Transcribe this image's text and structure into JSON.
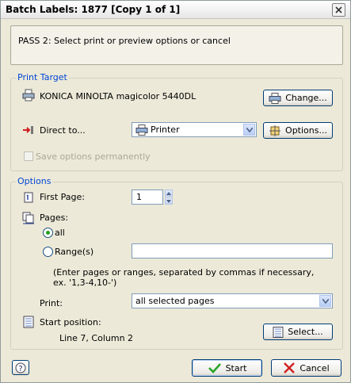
{
  "window": {
    "title": "Batch Labels: 1877 [Copy 1 of 1]"
  },
  "info": {
    "text": "PASS 2: Select print or preview options or cancel"
  },
  "print_target": {
    "legend": "Print Target",
    "printer_name": "KONICA MINOLTA magicolor 5440DL",
    "change_label": "Change...",
    "direct_to_label": "Direct to...",
    "direct_to_value": "Printer",
    "options_label": "Options...",
    "save_options_label": "Save options permanently",
    "save_options_checked": false
  },
  "options": {
    "legend": "Options",
    "first_page_label": "First Page:",
    "first_page_value": "1",
    "pages_label": "Pages:",
    "all_label": "all",
    "ranges_label": "Range(s)",
    "ranges_value": "",
    "selected_pages": "all",
    "hint_line1": "(Enter pages or ranges, separated by commas if necessary,",
    "hint_line2": "ex. '1,3-4,10-')",
    "print_label": "Print:",
    "print_value": "all selected pages",
    "start_position_label": "Start position:",
    "start_position_value": "Line 7, Column 2",
    "select_label": "Select..."
  },
  "footer": {
    "help_icon": "help-icon",
    "start_label": "Start",
    "cancel_label": "Cancel"
  },
  "colors": {
    "accent": "#0046d5",
    "start_check": "#2aa52a",
    "cancel_x": "#d02020"
  }
}
